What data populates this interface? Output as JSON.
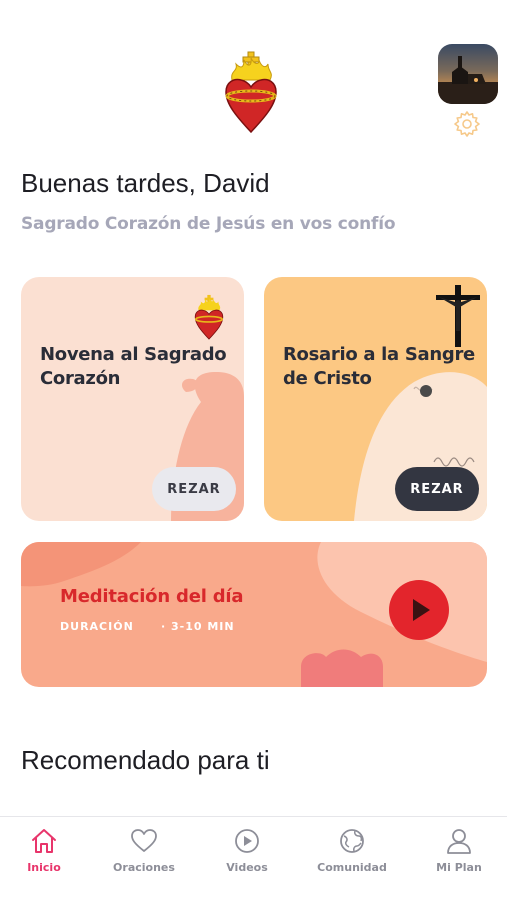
{
  "header": {
    "logo_icon": "sacred-heart-icon",
    "avatar_icon": "profile-photo",
    "settings_icon": "gear-icon"
  },
  "greeting": "Buenas tardes, David",
  "subtitle": "Sagrado Corazón de Jesús en vos confío",
  "cards": [
    {
      "title": "Novena al Sagrado Corazón",
      "button": "REZAR",
      "icon": "sacred-heart-icon"
    },
    {
      "title": "Rosario a la Sangre de Cristo",
      "button": "REZAR",
      "icon": "crucifix-icon"
    }
  ],
  "meditation": {
    "title": "Meditación del día",
    "duration_label": "DURACIÓN",
    "duration_value": "· 3-10 MIN",
    "play_icon": "play-icon"
  },
  "section_title": "Recomendado para ti",
  "tabs": [
    {
      "label": "Inicio",
      "icon": "home-icon",
      "active": true
    },
    {
      "label": "Oraciones",
      "icon": "heart-icon",
      "active": false
    },
    {
      "label": "Videos",
      "icon": "play-circle-icon",
      "active": false
    },
    {
      "label": "Comunidad",
      "icon": "globe-icon",
      "active": false
    },
    {
      "label": "Mi Plan",
      "icon": "person-icon",
      "active": false
    }
  ],
  "colors": {
    "accent": "#e8356b",
    "meditation_title": "#d8282b",
    "novena_card": "#fbe0d2",
    "rosario_card": "#fcc883",
    "meditation_card": "#f9a98b"
  }
}
